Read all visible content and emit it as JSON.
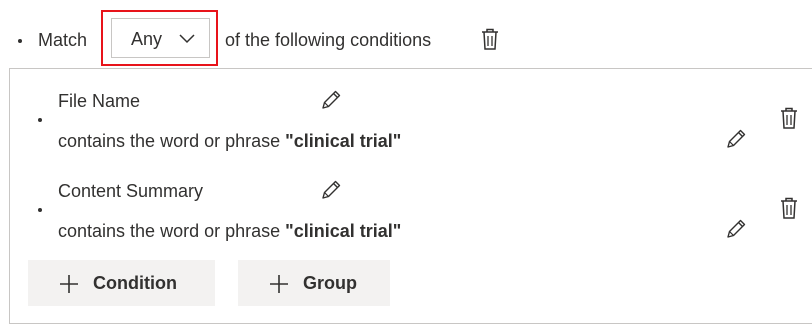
{
  "match": {
    "prefix": "Match",
    "selected": "Any",
    "suffix": "of the following conditions"
  },
  "conditions": [
    {
      "name": "File Name",
      "description_prefix": "contains the word or phrase",
      "value": "\"clinical trial\""
    },
    {
      "name": "Content Summary",
      "description_prefix": "contains the word or phrase",
      "value": "\"clinical trial\""
    }
  ],
  "actions": {
    "add_condition": "Condition",
    "add_group": "Group"
  },
  "colors": {
    "highlight_border": "#e8131a",
    "button_background": "#f3f2f1",
    "text": "#323130",
    "border": "#c8c6c4"
  },
  "icons": [
    "chevron-down-icon",
    "trash-icon",
    "pencil-icon",
    "plus-icon"
  ]
}
